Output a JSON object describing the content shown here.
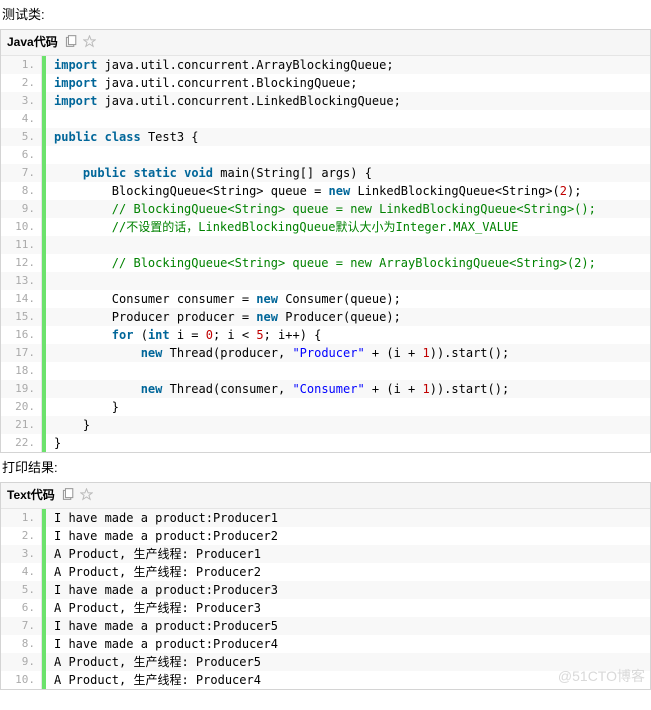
{
  "sections": {
    "test_class_label": "测试类:",
    "print_result_label": "打印结果:"
  },
  "java_block": {
    "title": "Java代码",
    "copy_icon_name": "copy-icon",
    "star_icon_name": "star-icon",
    "lines": [
      [
        [
          "kw",
          "import"
        ],
        [
          "plain",
          " java.util.concurrent.ArrayBlockingQueue;  "
        ]
      ],
      [
        [
          "kw",
          "import"
        ],
        [
          "plain",
          " java.util.concurrent.BlockingQueue;  "
        ]
      ],
      [
        [
          "kw",
          "import"
        ],
        [
          "plain",
          " java.util.concurrent.LinkedBlockingQueue;  "
        ]
      ],
      [
        [
          "plain",
          "  "
        ]
      ],
      [
        [
          "kw",
          "public"
        ],
        [
          "plain",
          " "
        ],
        [
          "kw",
          "class"
        ],
        [
          "plain",
          " Test3 {  "
        ]
      ],
      [
        [
          "plain",
          "  "
        ]
      ],
      [
        [
          "plain",
          "    "
        ],
        [
          "kw",
          "public"
        ],
        [
          "plain",
          " "
        ],
        [
          "kw",
          "static"
        ],
        [
          "plain",
          " "
        ],
        [
          "kw",
          "void"
        ],
        [
          "plain",
          " main(String[] args) {  "
        ]
      ],
      [
        [
          "plain",
          "        BlockingQueue<String> queue = "
        ],
        [
          "kw",
          "new"
        ],
        [
          "plain",
          " LinkedBlockingQueue<String>("
        ],
        [
          "num",
          "2"
        ],
        [
          "plain",
          ");  "
        ]
      ],
      [
        [
          "plain",
          "        "
        ],
        [
          "cm",
          "// BlockingQueue<String> queue = new LinkedBlockingQueue<String>();  "
        ]
      ],
      [
        [
          "plain",
          "        "
        ],
        [
          "cm",
          "//不设置的话，LinkedBlockingQueue默认大小为Integer.MAX_VALUE  "
        ]
      ],
      [
        [
          "plain",
          "          "
        ]
      ],
      [
        [
          "plain",
          "        "
        ],
        [
          "cm",
          "// BlockingQueue<String> queue = new ArrayBlockingQueue<String>(2);  "
        ]
      ],
      [
        [
          "plain",
          "  "
        ]
      ],
      [
        [
          "plain",
          "        Consumer consumer = "
        ],
        [
          "kw",
          "new"
        ],
        [
          "plain",
          " Consumer(queue);  "
        ]
      ],
      [
        [
          "plain",
          "        Producer producer = "
        ],
        [
          "kw",
          "new"
        ],
        [
          "plain",
          " Producer(queue);  "
        ]
      ],
      [
        [
          "plain",
          "        "
        ],
        [
          "kw",
          "for"
        ],
        [
          "plain",
          " ("
        ],
        [
          "kw",
          "int"
        ],
        [
          "plain",
          " i = "
        ],
        [
          "num",
          "0"
        ],
        [
          "plain",
          "; i < "
        ],
        [
          "num",
          "5"
        ],
        [
          "plain",
          "; i++) {  "
        ]
      ],
      [
        [
          "plain",
          "            "
        ],
        [
          "kw",
          "new"
        ],
        [
          "plain",
          " Thread(producer, "
        ],
        [
          "str",
          "\"Producer\""
        ],
        [
          "plain",
          " + (i + "
        ],
        [
          "num",
          "1"
        ],
        [
          "plain",
          ")).start();  "
        ]
      ],
      [
        [
          "plain",
          "  "
        ]
      ],
      [
        [
          "plain",
          "            "
        ],
        [
          "kw",
          "new"
        ],
        [
          "plain",
          " Thread(consumer, "
        ],
        [
          "str",
          "\"Consumer\""
        ],
        [
          "plain",
          " + (i + "
        ],
        [
          "num",
          "1"
        ],
        [
          "plain",
          ")).start();  "
        ]
      ],
      [
        [
          "plain",
          "        }  "
        ]
      ],
      [
        [
          "plain",
          "    }  "
        ]
      ],
      [
        [
          "plain",
          "}  "
        ]
      ]
    ]
  },
  "text_block": {
    "title": "Text代码",
    "copy_icon_name": "copy-icon",
    "star_icon_name": "star-icon",
    "lines": [
      [
        [
          "plain",
          "I have made a product:Producer1  "
        ]
      ],
      [
        [
          "plain",
          "I have made a product:Producer2  "
        ]
      ],
      [
        [
          "plain",
          "A Product, 生产线程: Producer1  "
        ]
      ],
      [
        [
          "plain",
          "A Product, 生产线程: Producer2  "
        ]
      ],
      [
        [
          "plain",
          "I have made a product:Producer3  "
        ]
      ],
      [
        [
          "plain",
          "A Product, 生产线程: Producer3  "
        ]
      ],
      [
        [
          "plain",
          "I have made a product:Producer5  "
        ]
      ],
      [
        [
          "plain",
          "I have made a product:Producer4  "
        ]
      ],
      [
        [
          "plain",
          "A Product, 生产线程: Producer5  "
        ]
      ],
      [
        [
          "plain",
          "A Product, 生产线程: Producer4  "
        ]
      ]
    ]
  },
  "watermark": "@51CTO博客"
}
